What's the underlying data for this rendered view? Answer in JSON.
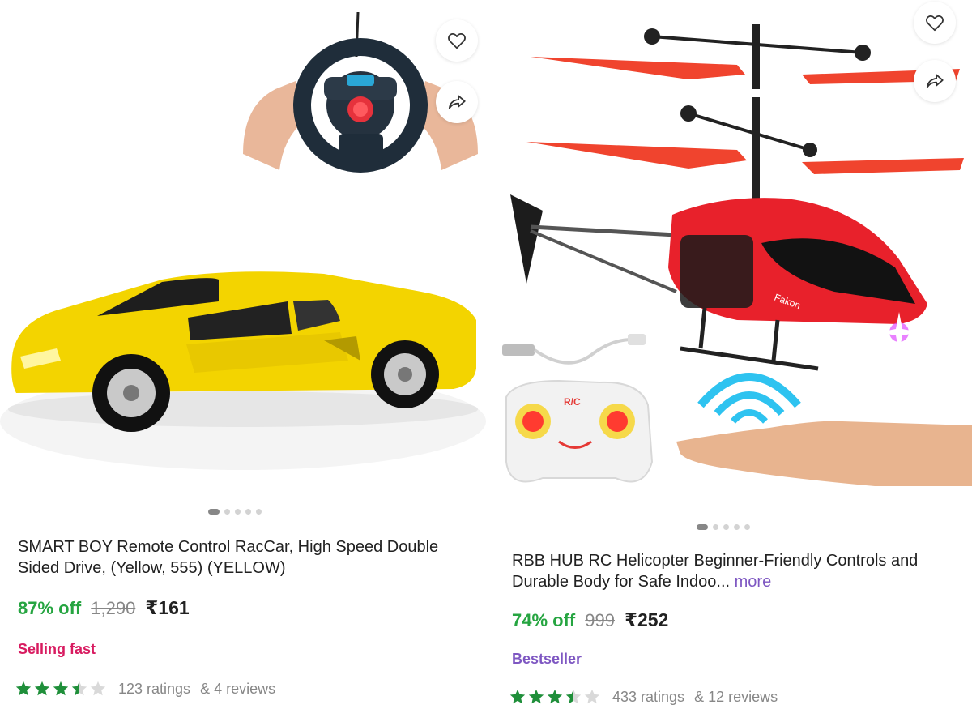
{
  "colors": {
    "discount": "#26a541",
    "selling_fast": "#d81b60",
    "bestseller": "#7e57c2",
    "star": "#1f8f3a",
    "star_empty": "#d9d9d9"
  },
  "products": [
    {
      "title": "SMART BOY Remote Control RacCar, High Speed Double Sided Drive, (Yellow, 555) (YELLOW)",
      "more": "",
      "discount": "87% off",
      "mrp": "1,290",
      "price": "₹161",
      "tag": "Selling fast",
      "rating": 3.5,
      "ratings": "123 ratings",
      "reviews": "& 4 reviews",
      "image_count": 5,
      "active_image": 1,
      "wishlist_icon": "heart-icon",
      "share_icon": "share-icon"
    },
    {
      "title": "RBB HUB RC Helicopter Beginner-Friendly Controls and Durable Body for Safe Indoo...",
      "more": "more",
      "discount": "74% off",
      "mrp": "999",
      "price": "₹252",
      "tag": "Bestseller",
      "rating": 3.5,
      "ratings": "433 ratings",
      "reviews": "& 12 reviews",
      "image_count": 5,
      "active_image": 1,
      "wishlist_icon": "heart-icon",
      "share_icon": "share-icon"
    }
  ]
}
